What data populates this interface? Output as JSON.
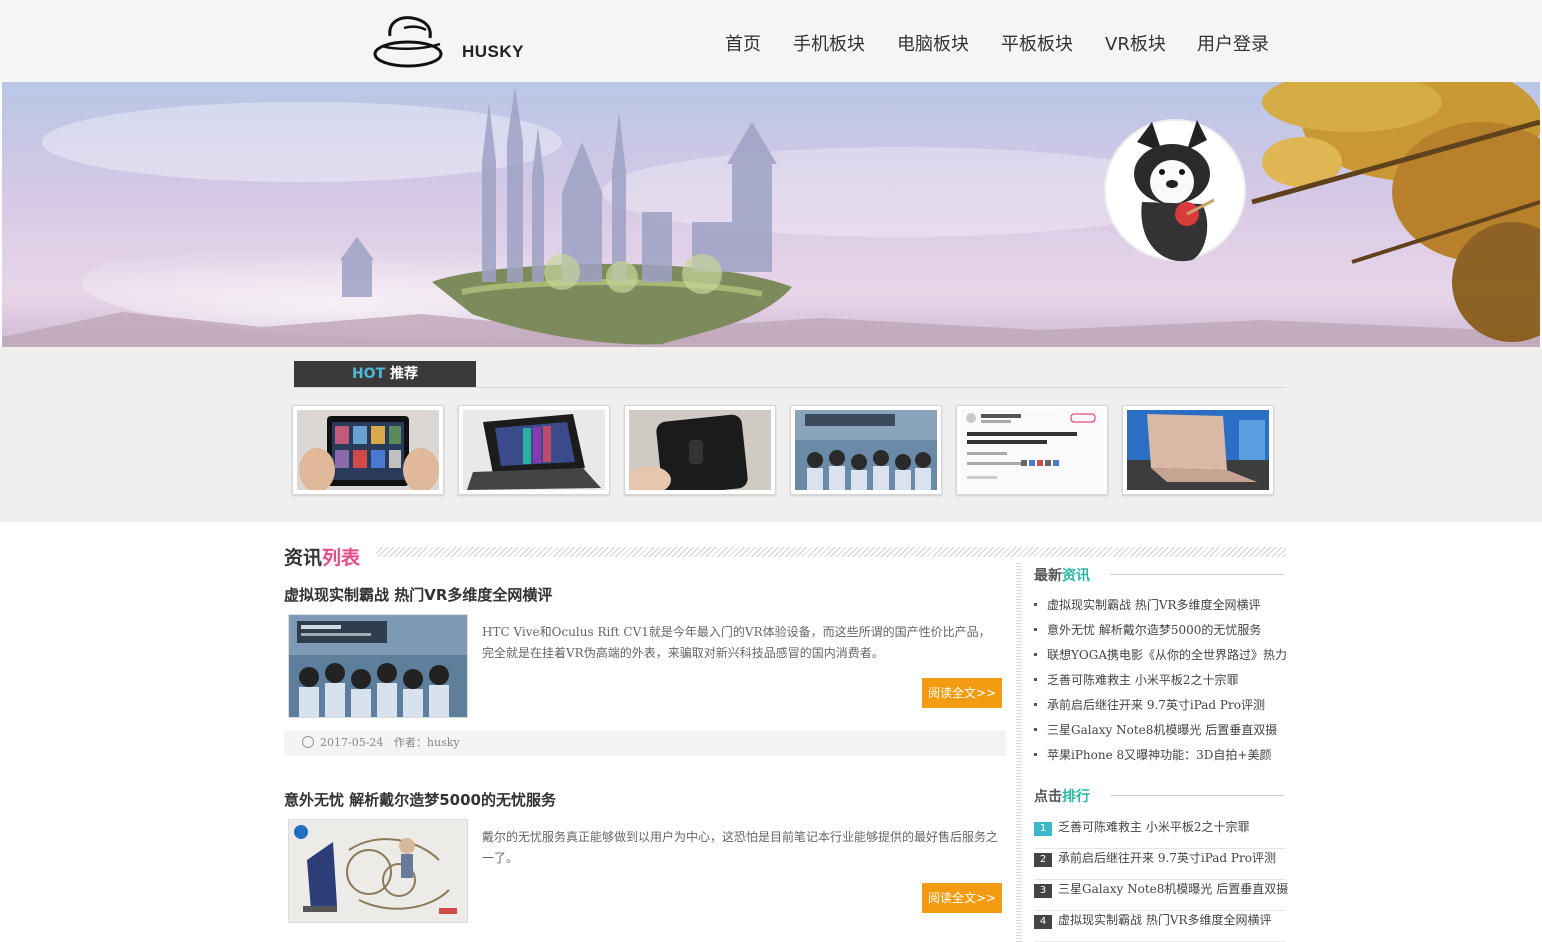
{
  "header": {
    "logo_text": "HUSKY",
    "nav": [
      "首页",
      "手机板块",
      "电脑板块",
      "平板板块",
      "VR板块",
      "用户登录"
    ]
  },
  "hot": {
    "tab_hot": "HOT",
    "tab_label": " 推荐"
  },
  "list_section": {
    "title_a": "资讯",
    "title_b": "列表"
  },
  "articles": [
    {
      "title": "虚拟现实制霸战 热门VR多维度全网横评",
      "desc": "HTC Vive和Oculus Rift CV1就是今年最入门的VR体验设备，而这些所谓的国产性价比产品，完全就是在挂着VR伪高端的外表，来骗取对新兴科技品感冒的国内消费者。",
      "read_more": "阅读全文>>",
      "date": "2017-05-24",
      "author": "作者：husky"
    },
    {
      "title": "意外无忧 解析戴尔造梦5000的无忧服务",
      "desc": "戴尔的无忧服务真正能够做到以用户为中心，这恐怕是目前笔记本行业能够提供的最好售后服务之一了。",
      "read_more": "阅读全文>>"
    }
  ],
  "sidebar": {
    "latest_a": "最新",
    "latest_b": "资讯",
    "latest": [
      "虚拟现实制霸战 热门VR多维度全网横评",
      "意外无忧 解析戴尔造梦5000的无忧服务",
      "联想YOGA携电影《从你的全世界路过》热力",
      "乏善可陈难救主 小米平板2之十宗罪",
      "承前启后继往开来 9.7英寸iPad Pro评测",
      "三星Galaxy Note8机模曝光 后置垂直双摄",
      "苹果iPhone 8又曝神功能：3D自拍+美颜"
    ],
    "rank_a": "点击",
    "rank_b": "排行",
    "ranking": [
      {
        "num": "1",
        "text": "乏善可陈难救主 小米平板2之十宗罪"
      },
      {
        "num": "2",
        "text": "承前启后继往开来 9.7英寸iPad Pro评测"
      },
      {
        "num": "3",
        "text": "三星Galaxy Note8机模曝光 后置垂直双摄"
      },
      {
        "num": "4",
        "text": "虚拟现实制霸战 热门VR多维度全网横评"
      }
    ]
  },
  "colors": {
    "accent_orange": "#f39c12",
    "accent_pink": "#e64b8a",
    "accent_teal": "#2db8a6",
    "hot_blue": "#4fb7d8"
  }
}
